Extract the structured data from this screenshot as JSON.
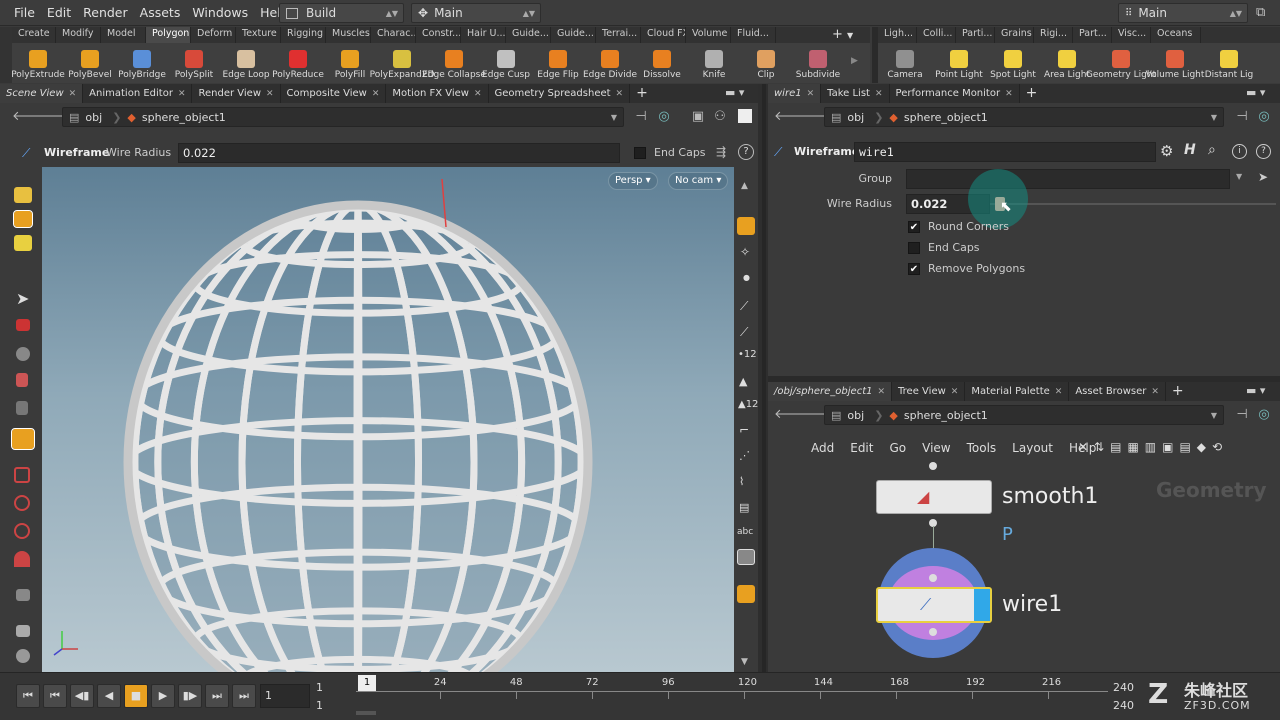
{
  "menu": [
    "File",
    "Edit",
    "Render",
    "Assets",
    "Windows",
    "Help"
  ],
  "desktop_combo": "Build",
  "context_combo": "Main",
  "right_combo": "Main",
  "left_shelf_tabs": [
    "Create",
    "Modify",
    "Model",
    "Polygon",
    "Deform",
    "Texture",
    "Rigging",
    "Muscles",
    "Charac...",
    "Constr...",
    "Hair U...",
    "Guide...",
    "Guide...",
    "Terrai...",
    "Cloud FX",
    "Volume",
    "Fluid..."
  ],
  "left_shelf_active": 3,
  "right_shelf_tabs": [
    "Ligh...",
    "Colli...",
    "Parti...",
    "Grains",
    "Rigi...",
    "Part...",
    "Visc...",
    "Oceans"
  ],
  "left_tools": [
    {
      "label": "PolyExtrude",
      "color": "#e8a020"
    },
    {
      "label": "PolyBevel",
      "color": "#e8a020"
    },
    {
      "label": "PolyBridge",
      "color": "#5a8fd8"
    },
    {
      "label": "PolySplit",
      "color": "#d84a3a"
    },
    {
      "label": "Edge Loop",
      "color": "#d8c0a0"
    },
    {
      "label": "PolyReduce",
      "color": "#e03030"
    },
    {
      "label": "PolyFill",
      "color": "#e8a020"
    },
    {
      "label": "PolyExpand2D",
      "color": "#d8c040"
    },
    {
      "label": "Edge Collapse",
      "color": "#e88020"
    },
    {
      "label": "Edge Cusp",
      "color": "#c0c0c0"
    },
    {
      "label": "Edge Flip",
      "color": "#e88020"
    },
    {
      "label": "Edge Divide",
      "color": "#e88020"
    },
    {
      "label": "Dissolve",
      "color": "#e88020"
    },
    {
      "label": "Knife",
      "color": "#b0b0b0"
    },
    {
      "label": "Clip",
      "color": "#e0a060"
    },
    {
      "label": "Subdivide",
      "color": "#c06070"
    }
  ],
  "right_tools": [
    {
      "label": "Camera",
      "color": "#909090"
    },
    {
      "label": "Point Light",
      "color": "#f0d040"
    },
    {
      "label": "Spot Light",
      "color": "#f0d040"
    },
    {
      "label": "Area Light",
      "color": "#f0d040"
    },
    {
      "label": "Geometry Light",
      "color": "#e06040"
    },
    {
      "label": "Volume Light",
      "color": "#e06040"
    },
    {
      "label": "Distant Lig",
      "color": "#f0d040"
    }
  ],
  "viewport_tabs": [
    "Scene View",
    "Animation Editor",
    "Render View",
    "Composite View",
    "Motion FX View",
    "Geometry Spreadsheet"
  ],
  "viewport_path": {
    "root": "obj",
    "node": "sphere_object1"
  },
  "viewport_op": {
    "title": "Wireframe",
    "param_label": "Wire Radius",
    "param_value": "0.022",
    "endcaps_label": "End Caps"
  },
  "viewport_buttons": {
    "persp": "Persp ▾",
    "cam": "No cam ▾"
  },
  "param_tabs": [
    "wire1",
    "Take List",
    "Performance Monitor"
  ],
  "param_path": {
    "root": "obj",
    "node": "sphere_object1"
  },
  "param_header": {
    "type": "Wireframe",
    "name": "wire1"
  },
  "params": {
    "group_label": "Group",
    "group_value": "",
    "radius_label": "Wire Radius",
    "radius_value": "0.022",
    "round_corners": "Round Corners",
    "end_caps": "End Caps",
    "remove_polygons": "Remove Polygons"
  },
  "checks": {
    "round_corners": true,
    "end_caps": false,
    "remove_polygons": true
  },
  "network_tabs": [
    "/obj/sphere_object1",
    "Tree View",
    "Material Palette",
    "Asset Browser"
  ],
  "network_path": {
    "root": "obj",
    "node": "sphere_object1"
  },
  "network_menu": [
    "Add",
    "Edit",
    "Go",
    "View",
    "Tools",
    "Layout",
    "Help"
  ],
  "network": {
    "context": "Geometry",
    "node1": "smooth1",
    "flag": "P",
    "node2": "wire1"
  },
  "timeline": {
    "frame": "1",
    "start": "1",
    "start2": "1",
    "current": "1",
    "ticks": [
      "24",
      "48",
      "72",
      "96",
      "120",
      "144",
      "168",
      "192",
      "216"
    ],
    "end": "240",
    "end2": "240"
  },
  "watermark": {
    "cn": "朱峰社区",
    "en": "ZF3D.COM"
  }
}
